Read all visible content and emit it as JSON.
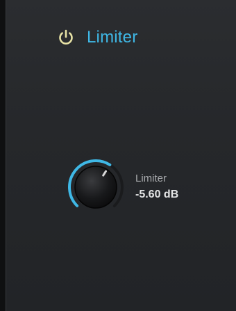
{
  "plugin": {
    "title": "Limiter",
    "power_icon": "power-icon",
    "power_color": "#e8e3a6",
    "accent_color": "#3fb8e6"
  },
  "knob": {
    "label": "Limiter",
    "value_text": "-5.60 dB",
    "normalized": 0.62
  }
}
